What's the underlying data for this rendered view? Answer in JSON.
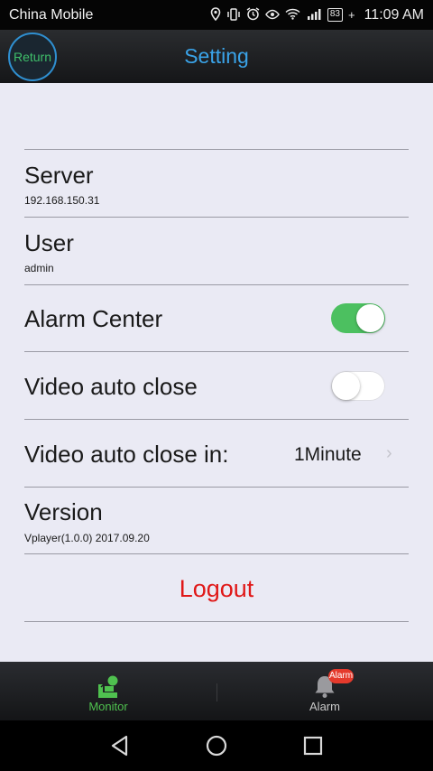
{
  "status_bar": {
    "carrier": "China Mobile",
    "signal": "⁴ᴳ",
    "battery": "83",
    "time": "11:09 AM"
  },
  "header": {
    "return_label": "Return",
    "title": "Setting"
  },
  "settings": {
    "server": {
      "label": "Server",
      "value": "192.168.150.31"
    },
    "user": {
      "label": "User",
      "value": "admin"
    },
    "alarm_center": {
      "label": "Alarm Center",
      "enabled": true
    },
    "video_auto_close": {
      "label": "Video auto close",
      "enabled": false
    },
    "video_auto_close_in": {
      "label": "Video auto close in:",
      "value": "1Minute"
    },
    "version": {
      "label": "Version",
      "value": "Vplayer(1.0.0) 2017.09.20"
    },
    "logout_label": "Logout"
  },
  "tabbar": {
    "monitor_label": "Monitor",
    "alarm_label": "Alarm",
    "alarm_badge": "Alarm"
  },
  "colors": {
    "accent_blue": "#3aa3e8",
    "toggle_on": "#4cc060",
    "logout_red": "#e01818",
    "tab_active": "#4fc14f"
  }
}
